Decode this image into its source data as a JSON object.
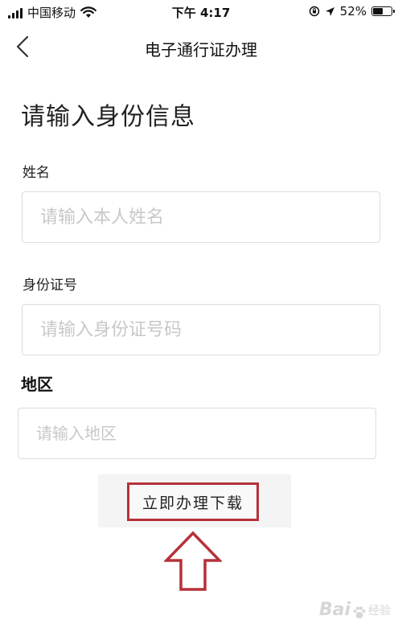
{
  "status_bar": {
    "carrier": "中国移动",
    "time": "下午 4:17",
    "battery_percent": "52%",
    "battery_level": 0.52,
    "icons": [
      "signal-icon",
      "wifi-icon",
      "orientation-lock-icon",
      "location-arrow-icon",
      "battery-icon"
    ]
  },
  "nav": {
    "title": "电子通行证办理",
    "back_icon": "chevron-left-icon"
  },
  "form": {
    "heading": "请输入身份信息",
    "name_label": "姓名",
    "name_placeholder": "请输入本人姓名",
    "id_label": "身份证号",
    "id_placeholder": "请输入身份证号码",
    "region_label": "地区",
    "region_placeholder": "请输入地区"
  },
  "actions": {
    "download_label": "立即办理下载",
    "highlight_color": "#b5313a",
    "arrow_icon": "up-arrow-icon"
  },
  "watermark": {
    "brand": "Bai",
    "suffix": "经验"
  }
}
